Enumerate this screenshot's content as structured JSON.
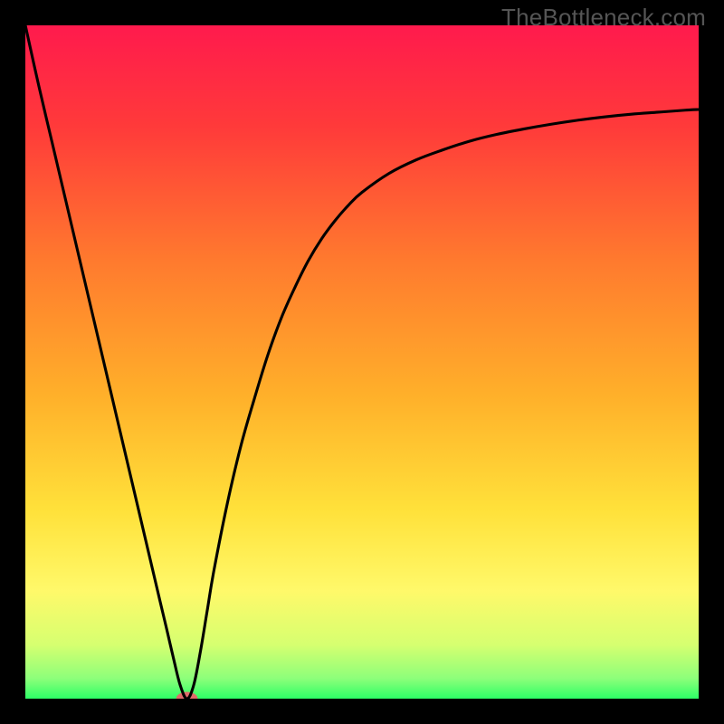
{
  "watermark": "TheBottleneck.com",
  "chart_data": {
    "type": "line",
    "title": "",
    "xlabel": "",
    "ylabel": "",
    "xlim": [
      0,
      100
    ],
    "ylim": [
      0,
      100
    ],
    "grid": false,
    "legend": false,
    "axes_visible": false,
    "background_gradient": {
      "stops": [
        {
          "offset": 0.0,
          "color": "#ff1a4d"
        },
        {
          "offset": 0.15,
          "color": "#ff3a3a"
        },
        {
          "offset": 0.35,
          "color": "#ff7a2e"
        },
        {
          "offset": 0.55,
          "color": "#ffb02a"
        },
        {
          "offset": 0.72,
          "color": "#ffe13a"
        },
        {
          "offset": 0.84,
          "color": "#fff96a"
        },
        {
          "offset": 0.92,
          "color": "#d6ff70"
        },
        {
          "offset": 0.97,
          "color": "#8dff7a"
        },
        {
          "offset": 1.0,
          "color": "#2dff66"
        }
      ]
    },
    "series": [
      {
        "name": "curve",
        "color": "#000000",
        "x": [
          0,
          2,
          4,
          6,
          8,
          10,
          12,
          14,
          16,
          18,
          20,
          21,
          22,
          23,
          24,
          25,
          26,
          27,
          28,
          30,
          32,
          34,
          36,
          38,
          40,
          42,
          44,
          46,
          48,
          50,
          54,
          58,
          62,
          66,
          70,
          74,
          78,
          82,
          86,
          90,
          94,
          98,
          100
        ],
        "y": [
          100,
          91,
          82.5,
          74,
          65.5,
          57,
          48.5,
          40,
          31.5,
          23,
          14.5,
          10.3,
          6,
          2,
          0,
          2,
          7,
          13,
          19,
          29,
          37.5,
          44.5,
          51,
          56.5,
          61,
          65,
          68.3,
          71,
          73.3,
          75.2,
          78,
          80,
          81.5,
          82.8,
          83.8,
          84.6,
          85.3,
          85.9,
          86.4,
          86.8,
          87.1,
          87.4,
          87.5
        ]
      }
    ],
    "markers": [
      {
        "name": "minimum-marker",
        "shape": "ellipse",
        "x": 24,
        "y": 0,
        "rx": 1.6,
        "ry": 1.0,
        "color": "#e06a6a"
      }
    ]
  }
}
